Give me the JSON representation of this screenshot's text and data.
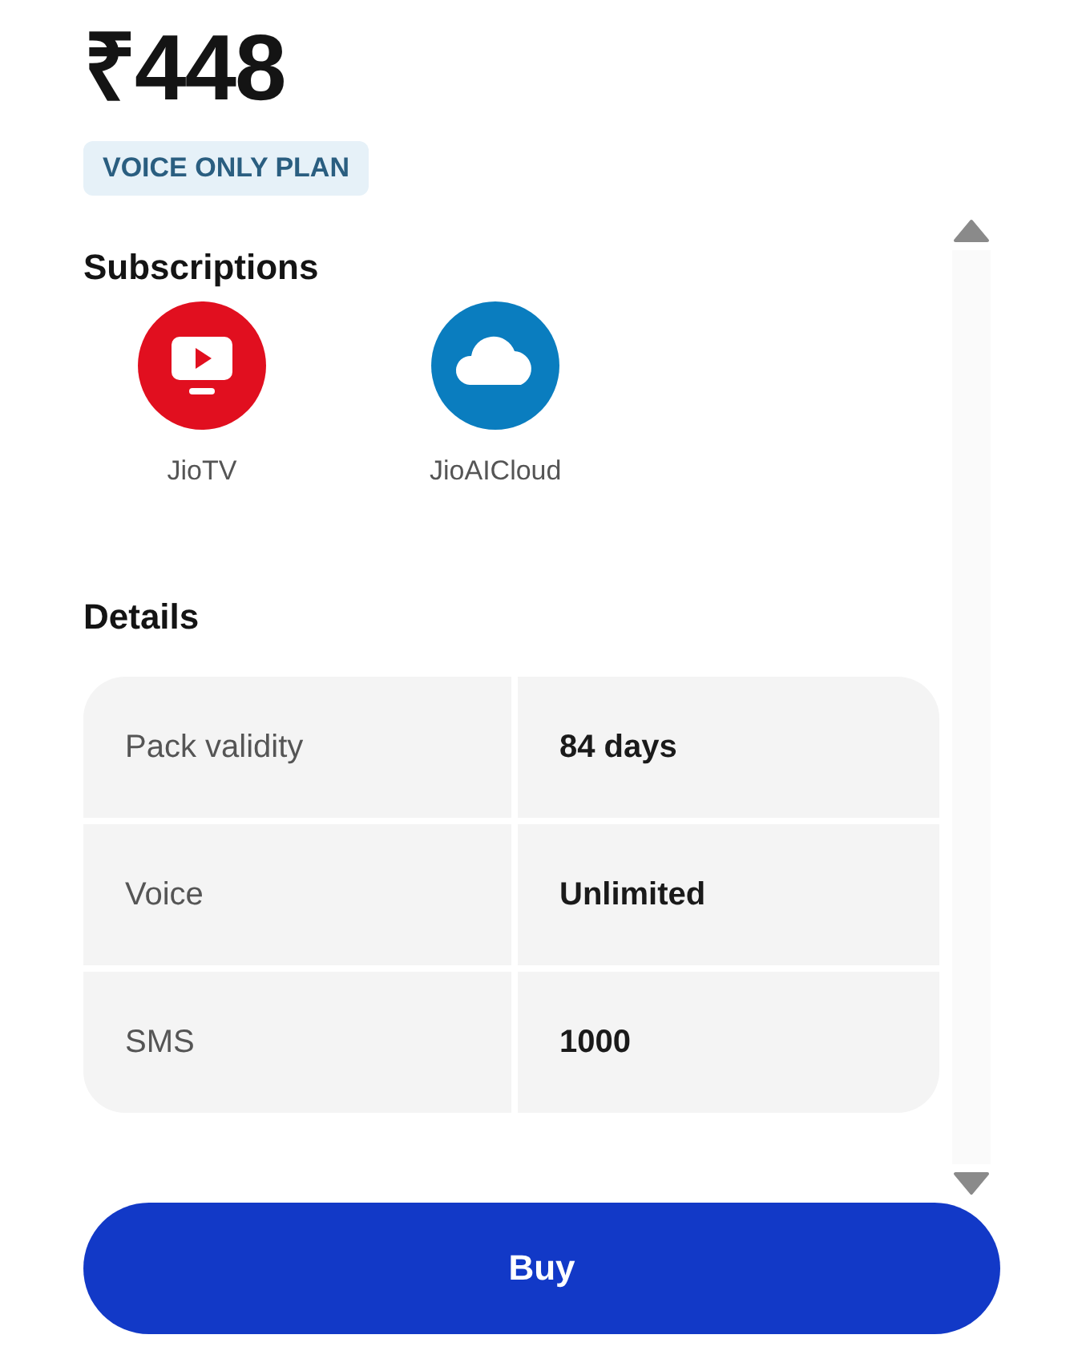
{
  "price": "₹448",
  "plan_badge": "VOICE ONLY PLAN",
  "subscriptions": {
    "heading": "Subscriptions",
    "items": [
      {
        "name": "JioTV",
        "kind": "tv",
        "color": "#e10f1f"
      },
      {
        "name": "JioAICloud",
        "kind": "cloud",
        "color": "#0a7dbf"
      }
    ]
  },
  "details": {
    "heading": "Details",
    "rows": [
      {
        "label": "Pack validity",
        "value": "84 days"
      },
      {
        "label": "Voice",
        "value": "Unlimited"
      },
      {
        "label": "SMS",
        "value": "1000"
      }
    ]
  },
  "buy_button": "Buy"
}
